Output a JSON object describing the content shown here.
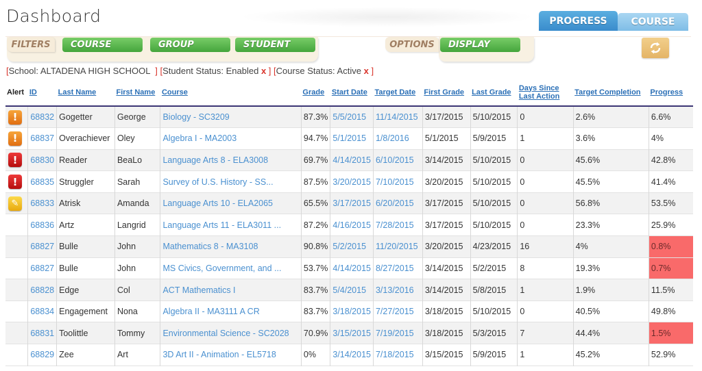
{
  "page": {
    "title": "Dashboard"
  },
  "top_tabs": [
    {
      "label": "PROGRESS",
      "active": true
    },
    {
      "label": "COURSE",
      "active": false
    }
  ],
  "filters": {
    "label": "FILTERS",
    "buttons": [
      "COURSE",
      "GROUP",
      "STUDENT"
    ]
  },
  "options": {
    "label": "OPTIONS",
    "buttons": [
      "DISPLAY"
    ]
  },
  "refresh": {
    "icon": "refresh-icon"
  },
  "active_filters": {
    "school": "School: ALTADENA HIGH SCHOOL  ",
    "student_status": "Student Status: Enabled ",
    "course_status": "Course Status: Active ",
    "remove_label": "x"
  },
  "colors": {
    "accent_blue": "#3a8ccc",
    "button_green": "#45a53c",
    "low_progress": "#f96a6a",
    "alert_orange": "#e06e12",
    "alert_red": "#b50d0d",
    "alert_yellow": "#e8a90e"
  },
  "table": {
    "headers": {
      "alert": "Alert",
      "id": "ID",
      "last_name": "Last Name",
      "first_name": "First Name",
      "course": "Course",
      "grade": "Grade",
      "start_date": "Start Date",
      "target_date": "Target Date",
      "first_grade": "First Grade",
      "last_grade": "Last Grade",
      "days_since_1": "Days Since",
      "days_since_2": "Last Action",
      "target_completion": "Target Completion",
      "progress": "Progress"
    },
    "rows": [
      {
        "alert": "orange-warning",
        "id": "68832",
        "last": "Gogetter",
        "first": "George",
        "course": "Biology - SC3209",
        "grade": "87.3%",
        "start": "5/5/2015",
        "target": "11/14/2015",
        "first_grade": "3/17/2015",
        "last_grade": "5/10/2015",
        "days": "0",
        "target_completion": "2.6%",
        "progress": "6.6%",
        "low": false
      },
      {
        "alert": "orange-warning",
        "id": "68837",
        "last": "Overachiever",
        "first": "Oley",
        "course": "Algebra I - MA2003",
        "grade": "94.7%",
        "start": "5/1/2015",
        "target": "1/8/2016",
        "first_grade": "5/1/2015",
        "last_grade": "5/9/2015",
        "days": "1",
        "target_completion": "3.6%",
        "progress": "4%",
        "low": false
      },
      {
        "alert": "red-warning",
        "id": "68830",
        "last": "Reader",
        "first": "BeaLo",
        "course": "Language Arts 8 - ELA3008",
        "grade": "69.7%",
        "start": "4/14/2015",
        "target": "6/10/2015",
        "first_grade": "3/14/2015",
        "last_grade": "5/10/2015",
        "days": "0",
        "target_completion": "45.6%",
        "progress": "42.8%",
        "low": false
      },
      {
        "alert": "red-warning",
        "id": "68835",
        "last": "Struggler",
        "first": "Sarah",
        "course": "Survey of U.S. History - SS...",
        "grade": "87.5%",
        "start": "3/20/2015",
        "target": "7/10/2015",
        "first_grade": "3/20/2015",
        "last_grade": "5/10/2015",
        "days": "0",
        "target_completion": "45.5%",
        "progress": "41.4%",
        "low": false
      },
      {
        "alert": "yellow-note",
        "id": "68833",
        "last": "Atrisk",
        "first": "Amanda",
        "course": "Language Arts 10 - ELA2065",
        "grade": "65.5%",
        "start": "3/17/2015",
        "target": "6/20/2015",
        "first_grade": "3/17/2015",
        "last_grade": "5/10/2015",
        "days": "0",
        "target_completion": "56.8%",
        "progress": "53.5%",
        "low": false
      },
      {
        "alert": "",
        "id": "68836",
        "last": "Artz",
        "first": "Langrid",
        "course": "Language Arts 11 - ELA3011 ...",
        "grade": "87.2%",
        "start": "4/16/2015",
        "target": "7/28/2015",
        "first_grade": "3/17/2015",
        "last_grade": "5/10/2015",
        "days": "0",
        "target_completion": "23.3%",
        "progress": "25.9%",
        "low": false
      },
      {
        "alert": "",
        "id": "68827",
        "last": "Bulle",
        "first": "John",
        "course": "Mathematics 8 - MA3108",
        "grade": "90.8%",
        "start": "5/2/2015",
        "target": "11/20/2015",
        "first_grade": "3/20/2015",
        "last_grade": "4/23/2015",
        "days": "16",
        "target_completion": "4%",
        "progress": "0.8%",
        "low": true
      },
      {
        "alert": "",
        "id": "68827",
        "last": "Bulle",
        "first": "John",
        "course": "MS Civics, Government, and ...",
        "grade": "53.7%",
        "start": "4/14/2015",
        "target": "8/27/2015",
        "first_grade": "3/14/2015",
        "last_grade": "5/2/2015",
        "days": "8",
        "target_completion": "19.3%",
        "progress": "0.7%",
        "low": true
      },
      {
        "alert": "",
        "id": "68828",
        "last": "Edge",
        "first": "Col",
        "course": "ACT Mathematics I",
        "grade": "83.7%",
        "start": "5/4/2015",
        "target": "3/13/2016",
        "first_grade": "3/14/2015",
        "last_grade": "5/8/2015",
        "days": "1",
        "target_completion": "1.9%",
        "progress": "11.5%",
        "low": false
      },
      {
        "alert": "",
        "id": "68834",
        "last": "Engagement",
        "first": "Nona",
        "course": "Algebra II - MA3111 A CR",
        "grade": "83.7%",
        "start": "3/18/2015",
        "target": "7/27/2015",
        "first_grade": "3/18/2015",
        "last_grade": "5/10/2015",
        "days": "0",
        "target_completion": "40.5%",
        "progress": "49.8%",
        "low": false
      },
      {
        "alert": "",
        "id": "68831",
        "last": "Toolittle",
        "first": "Tommy",
        "course": "Environmental Science - SC2028",
        "grade": "70.9%",
        "start": "3/15/2015",
        "target": "7/19/2015",
        "first_grade": "3/18/2015",
        "last_grade": "5/3/2015",
        "days": "7",
        "target_completion": "44.4%",
        "progress": "1.5%",
        "low": true
      },
      {
        "alert": "",
        "id": "68829",
        "last": "Zee",
        "first": "Art",
        "course": "3D Art II - Animation - EL5718",
        "grade": "0%",
        "start": "3/14/2015",
        "target": "7/18/2015",
        "first_grade": "3/15/2015",
        "last_grade": "5/9/2015",
        "days": "1",
        "target_completion": "45.2%",
        "progress": "52.9%",
        "low": false
      }
    ]
  }
}
